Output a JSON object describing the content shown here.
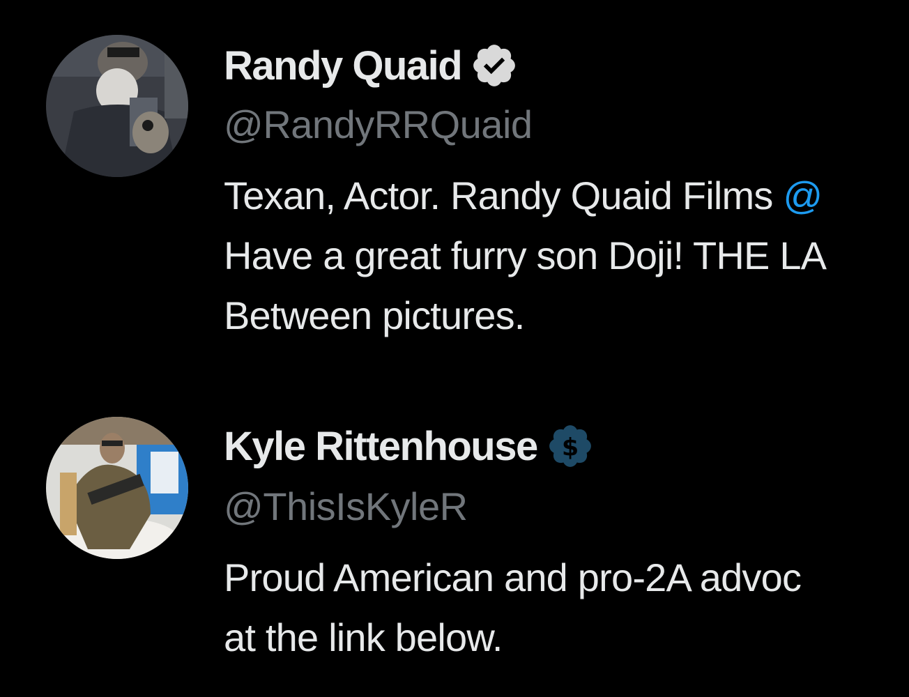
{
  "users": [
    {
      "display_name": "Randy Quaid",
      "handle": "@RandyRRQuaid",
      "badge": "verified-check-icon",
      "badge_color": "#d9d9d9",
      "bio_lines": [
        "Texan, Actor. Randy Quaid Films ",
        "Have a great furry son Doji! THE LA",
        "Between pictures."
      ],
      "bio_mention": "@"
    },
    {
      "display_name": "Kyle Rittenhouse",
      "handle": "@ThisIsKyleR",
      "badge": "verified-dollar-badge-icon",
      "badge_color": "#1e4a66",
      "bio_lines": [
        "Proud American and pro-2A advoc",
        "at the link below."
      ]
    }
  ],
  "colors": {
    "background": "#000000",
    "primary_text": "#e7e9ea",
    "secondary_text": "#71767b",
    "link": "#1d9bf0"
  }
}
